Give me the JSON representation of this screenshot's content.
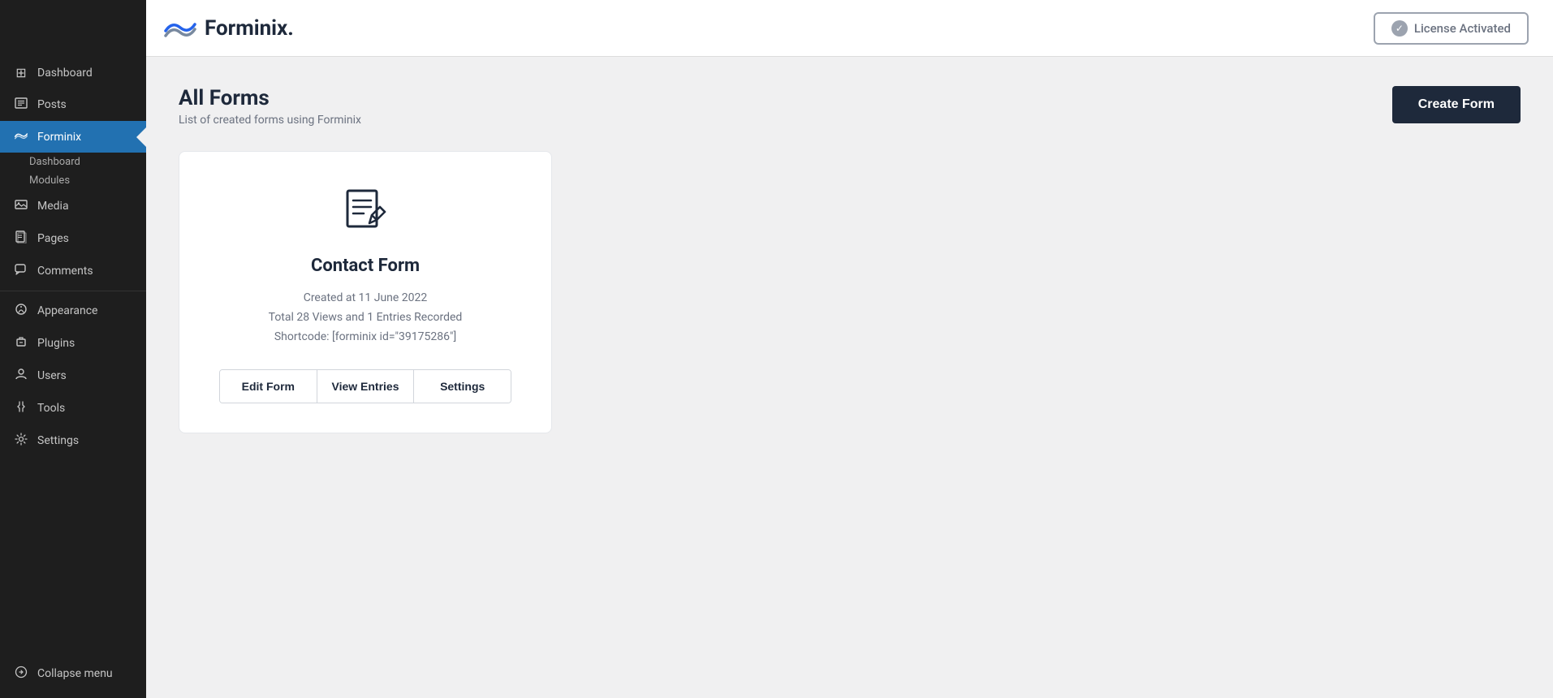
{
  "topbar": {
    "brand_name": "Forminix.",
    "license_label": "License Activated"
  },
  "sidebar": {
    "items": [
      {
        "id": "dashboard",
        "label": "Dashboard",
        "icon": "⊞"
      },
      {
        "id": "posts",
        "label": "Posts",
        "icon": "📄"
      },
      {
        "id": "forminix",
        "label": "Forminix",
        "icon": "🌊",
        "active": true
      },
      {
        "id": "media",
        "label": "Media",
        "icon": "🖼"
      },
      {
        "id": "pages",
        "label": "Pages",
        "icon": "📋"
      },
      {
        "id": "comments",
        "label": "Comments",
        "icon": "💬"
      },
      {
        "id": "appearance",
        "label": "Appearance",
        "icon": "🎨"
      },
      {
        "id": "plugins",
        "label": "Plugins",
        "icon": "🔌"
      },
      {
        "id": "users",
        "label": "Users",
        "icon": "👤"
      },
      {
        "id": "tools",
        "label": "Tools",
        "icon": "🔧"
      },
      {
        "id": "settings",
        "label": "Settings",
        "icon": "⚙"
      }
    ],
    "sub_items": [
      {
        "id": "sub-dashboard",
        "label": "Dashboard"
      },
      {
        "id": "sub-modules",
        "label": "Modules"
      }
    ],
    "collapse_label": "Collapse menu"
  },
  "main": {
    "page_title": "All Forms",
    "page_subtitle": "List of created forms using Forminix",
    "create_button_label": "Create Form",
    "form_card": {
      "title": "Contact Form",
      "created_date": "Created at 11 June 2022",
      "stats": "Total 28 Views and 1 Entries Recorded",
      "shortcode": "Shortcode: [forminix id=\"39175286\"]",
      "actions": [
        {
          "id": "edit-form",
          "label": "Edit Form"
        },
        {
          "id": "view-entries",
          "label": "View Entries"
        },
        {
          "id": "settings",
          "label": "Settings"
        }
      ]
    }
  }
}
